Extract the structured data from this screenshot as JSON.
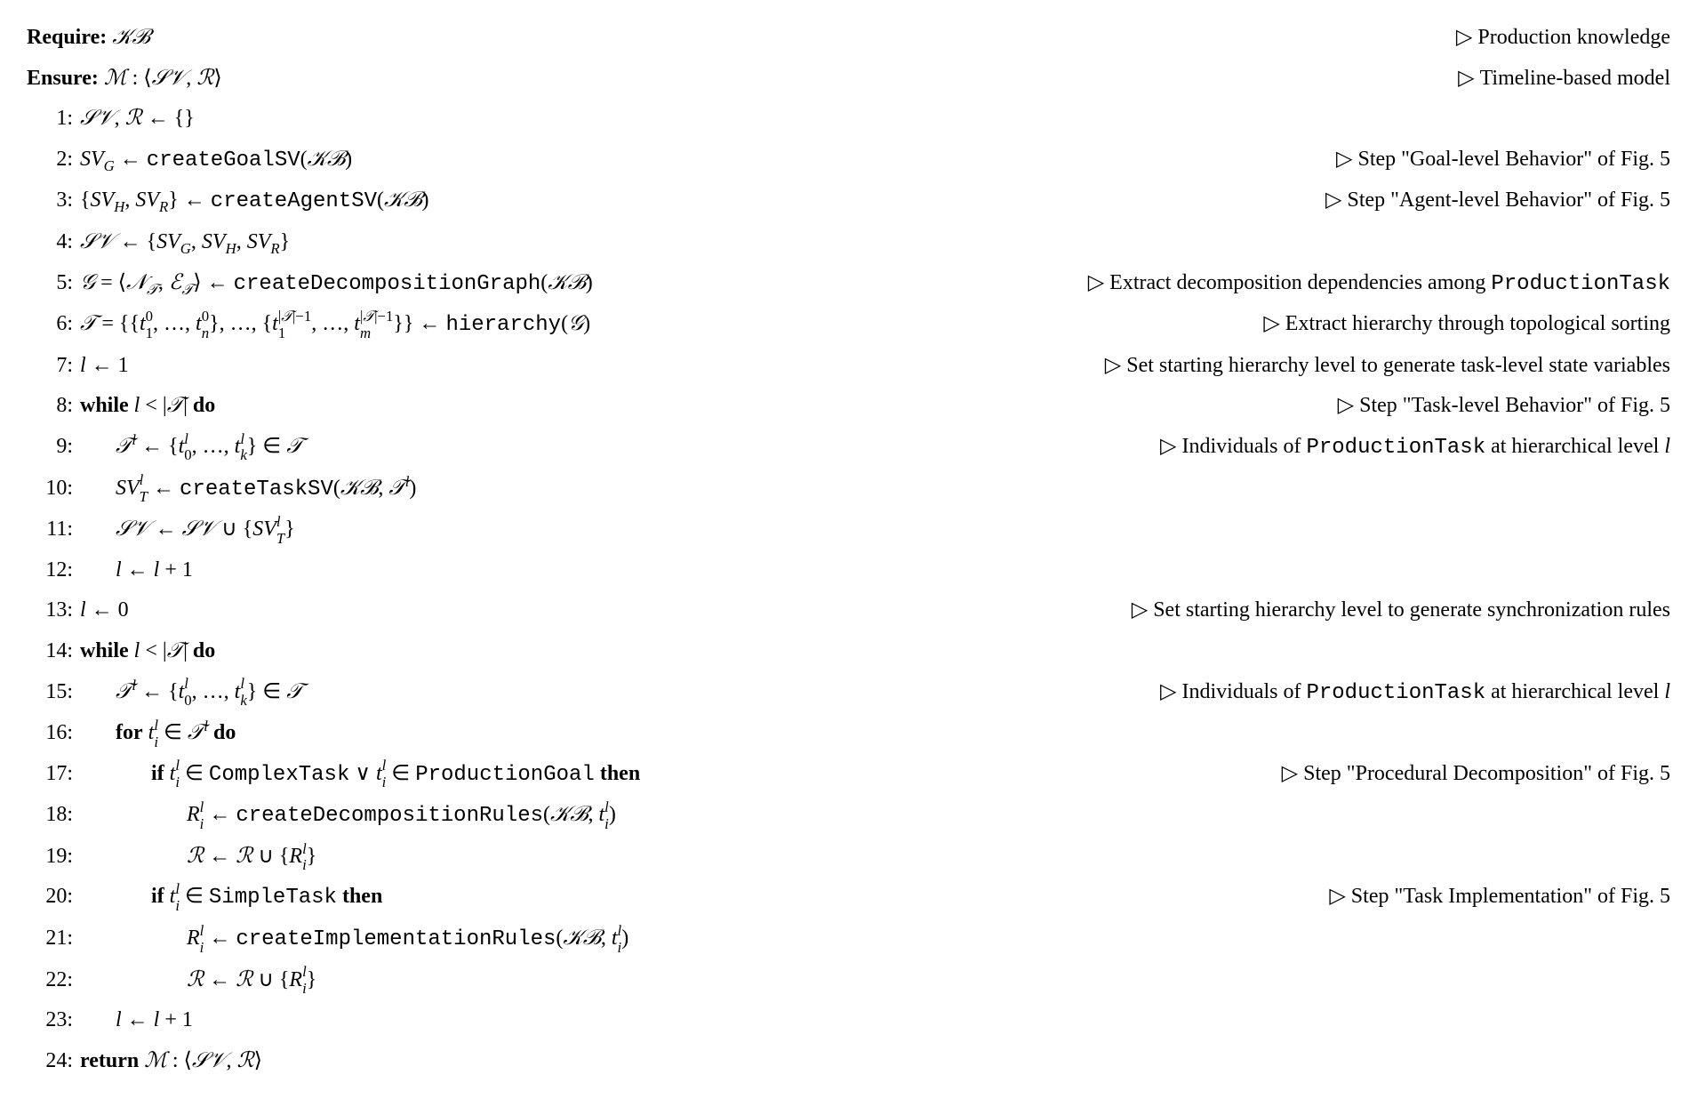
{
  "header": {
    "require_kw": "Require:",
    "require_val": "𝒦ℬ",
    "require_comment": "Production knowledge",
    "ensure_kw": "Ensure:",
    "ensure_val": "ℳ : ⟨𝒮𝒱, ℛ⟩",
    "ensure_comment": "Timeline-based model"
  },
  "lines": {
    "l1": {
      "no": "1:",
      "body": "𝒮𝒱, ℛ ← {}"
    },
    "l2": {
      "no": "2:",
      "body_pre": "SV",
      "body_sub": "G",
      "body_mid": " ← ",
      "fn": "createGoalSV",
      "body_arg": "(𝒦ℬ)",
      "comment": "Step \"Goal-level Behavior\" of Fig. 5"
    },
    "l3": {
      "no": "3:",
      "body": "{SV_H, SV_R} ← createAgentSV(𝒦ℬ)",
      "comment": "Step \"Agent-level Behavior\" of Fig. 5"
    },
    "l4": {
      "no": "4:",
      "body": "𝒮𝒱 ← {SV_G, SV_H, SV_R}"
    },
    "l5": {
      "no": "5:",
      "body": "𝒢 = ⟨𝒩_𝒯, ℰ_𝒯⟩ ← createDecompositionGraph(𝒦ℬ)",
      "comment_pre": "Extract decomposition dependencies among ",
      "comment_tt": "ProductionTask"
    },
    "l6": {
      "no": "6:",
      "body": "𝒯 = {{t_1^0, …, t_n^0}, …, {t_1^{|𝒯|−1}, …, t_m^{|𝒯|−1}}} ← hierarchy(𝒢)",
      "comment": "Extract hierarchy through topological sorting"
    },
    "l7": {
      "no": "7:",
      "body": "l ← 1",
      "comment": "Set starting hierarchy level to generate task-level state variables"
    },
    "l8": {
      "no": "8:",
      "kw1": "while",
      "cond": " l < |𝒯| ",
      "kw2": "do",
      "comment": "Step \"Task-level Behavior\" of Fig. 5"
    },
    "l9": {
      "no": "9:",
      "body": "𝒯^l ← {t_0^l, …, t_k^l} ∈ 𝒯",
      "comment_pre": "Individuals of ",
      "comment_tt": "ProductionTask",
      "comment_post": " at hierarchical level l"
    },
    "l10": {
      "no": "10:",
      "body": "SV_T^l ← createTaskSV(𝒦ℬ, 𝒯^l)"
    },
    "l11": {
      "no": "11:",
      "body": "𝒮𝒱 ← 𝒮𝒱 ∪ {SV_T^l}"
    },
    "l12": {
      "no": "12:",
      "body": "l ← l + 1"
    },
    "l13": {
      "no": "13:",
      "body": "l ← 0",
      "comment": "Set starting hierarchy level to generate synchronization rules"
    },
    "l14": {
      "no": "14:",
      "kw1": "while",
      "cond": " l < |𝒯| ",
      "kw2": "do"
    },
    "l15": {
      "no": "15:",
      "body": "𝒯^l ← {t_0^l, …, t_k^l} ∈ 𝒯",
      "comment_pre": "Individuals of ",
      "comment_tt": "ProductionTask",
      "comment_post": " at hierarchical level l"
    },
    "l16": {
      "no": "16:",
      "kw1": "for",
      "cond": " t_i^l ∈ 𝒯^l ",
      "kw2": "do"
    },
    "l17": {
      "no": "17:",
      "kw1": "if",
      "cond": " t_i^l ∈ ComplexTask ∨ t_i^l ∈ ProductionGoal ",
      "kw2": "then",
      "comment": "Step \"Procedural Decomposition\" of Fig. 5"
    },
    "l18": {
      "no": "18:",
      "body": "R_i^l ← createDecompositionRules(𝒦ℬ, t_i^l)"
    },
    "l19": {
      "no": "19:",
      "body": "ℛ ← ℛ ∪ {R_i^l}"
    },
    "l20": {
      "no": "20:",
      "kw1": "if",
      "cond": " t_i^l ∈ SimpleTask ",
      "kw2": "then",
      "comment": "Step \"Task Implementation\" of Fig. 5"
    },
    "l21": {
      "no": "21:",
      "body": "R_i^l ← createImplementationRules(𝒦ℬ, t_i^l)"
    },
    "l22": {
      "no": "22:",
      "body": "ℛ ← ℛ ∪ {R_i^l}"
    },
    "l23": {
      "no": "23:",
      "body": "l ← l + 1"
    },
    "l24": {
      "no": "24:",
      "kw1": "return",
      "body": " ℳ : ⟨𝒮𝒱, ℛ⟩"
    }
  }
}
